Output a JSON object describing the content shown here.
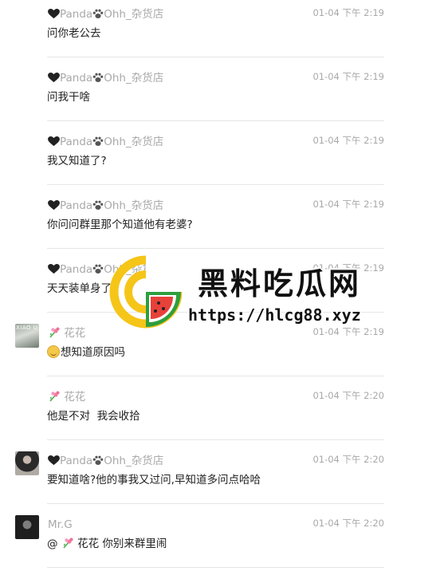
{
  "messages": [
    {
      "sender": "Panda",
      "sender_suffix": "Ohh_杂货店",
      "time": "01-04 下午 2:19",
      "text": "问你老公去"
    },
    {
      "sender": "Panda",
      "sender_suffix": "Ohh_杂货店",
      "time": "01-04 下午 2:19",
      "text": "问我干啥"
    },
    {
      "sender": "Panda",
      "sender_suffix": "Ohh_杂货店",
      "time": "01-04 下午 2:19",
      "text": "我又知道了?"
    },
    {
      "sender": "Panda",
      "sender_suffix": "Ohh_杂货店",
      "time": "01-04 下午 2:19",
      "text": "你问问群里那个知道他有老婆?"
    },
    {
      "sender": "Panda",
      "sender_suffix": "Ohh_杂货店",
      "time": "01-04 下午 2:19",
      "text": "天天装单身了"
    },
    {
      "sender": "花花",
      "avatar_text": "XIAO U",
      "time": "01-04 下午 2:19",
      "text": "想知道原因吗"
    },
    {
      "sender": "花花",
      "time": "01-04 下午 2:20",
      "text": "他是不对  我会收拾"
    },
    {
      "sender": "Panda",
      "sender_suffix": "Ohh_杂货店",
      "time": "01-04 下午 2:20",
      "text": "要知道啥?他的事我又过问,早知道多问点哈哈"
    },
    {
      "sender": "Mr.G",
      "time": "01-04 下午 2:20",
      "mention_prefix": "@",
      "mention_name": "花花",
      "text": "你别来群里闹"
    }
  ],
  "watermark": {
    "title": "黑料吃瓜网",
    "url": "https://hlcg88.xyz",
    "colors": {
      "ring": "#f5c518",
      "melon_green": "#2e9e3e",
      "melon_red": "#e8413a"
    }
  },
  "colors": {
    "meta_text": "#a9a9a9",
    "body_text": "#222222",
    "divider": "#e6e6e6"
  }
}
